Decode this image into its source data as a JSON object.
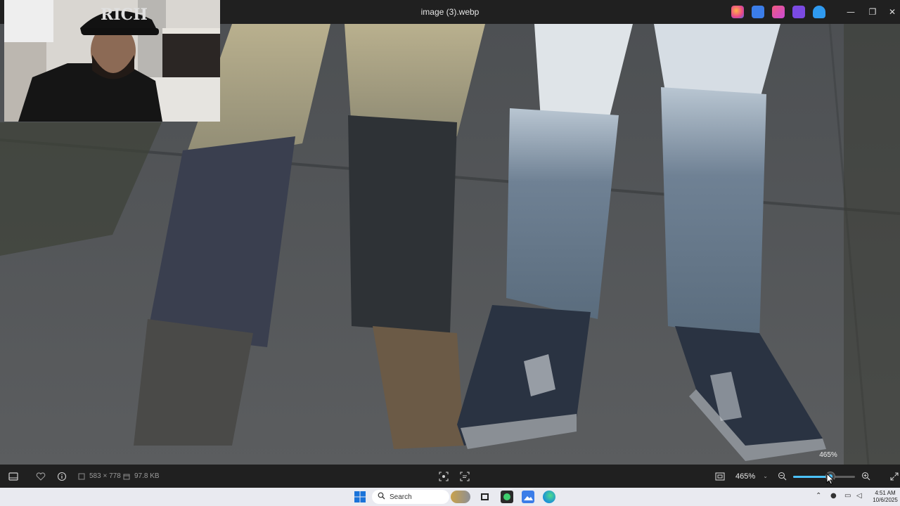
{
  "window": {
    "title": "image (3).webp",
    "minimize_glyph": "—",
    "restore_glyph": "❐",
    "close_glyph": "✕",
    "app_icons": [
      {
        "name": "copilot-icon",
        "color": "#e8468a"
      },
      {
        "name": "edit-pen-icon",
        "color": "#3b7de8"
      },
      {
        "name": "designer-icon",
        "color": "#c94ad6"
      },
      {
        "name": "clipchamp-icon",
        "color": "#7b4ae2"
      },
      {
        "name": "onedrive-icon",
        "color": "#2f9af0"
      }
    ]
  },
  "zoom_tooltip": "465%",
  "viewer_bar": {
    "dimensions": "583 × 778",
    "file_size": "97.8 KB",
    "zoom_value": "465%",
    "zoom_slider_fraction": 0.6
  },
  "taskbar": {
    "search_placeholder": "Search",
    "time": "4:51 AM",
    "date": "10/6/2025"
  },
  "colors": {
    "accent": "#4cc2ff",
    "titlebar_bg": "#202020",
    "taskbar_bg": "#e9eaf0"
  }
}
